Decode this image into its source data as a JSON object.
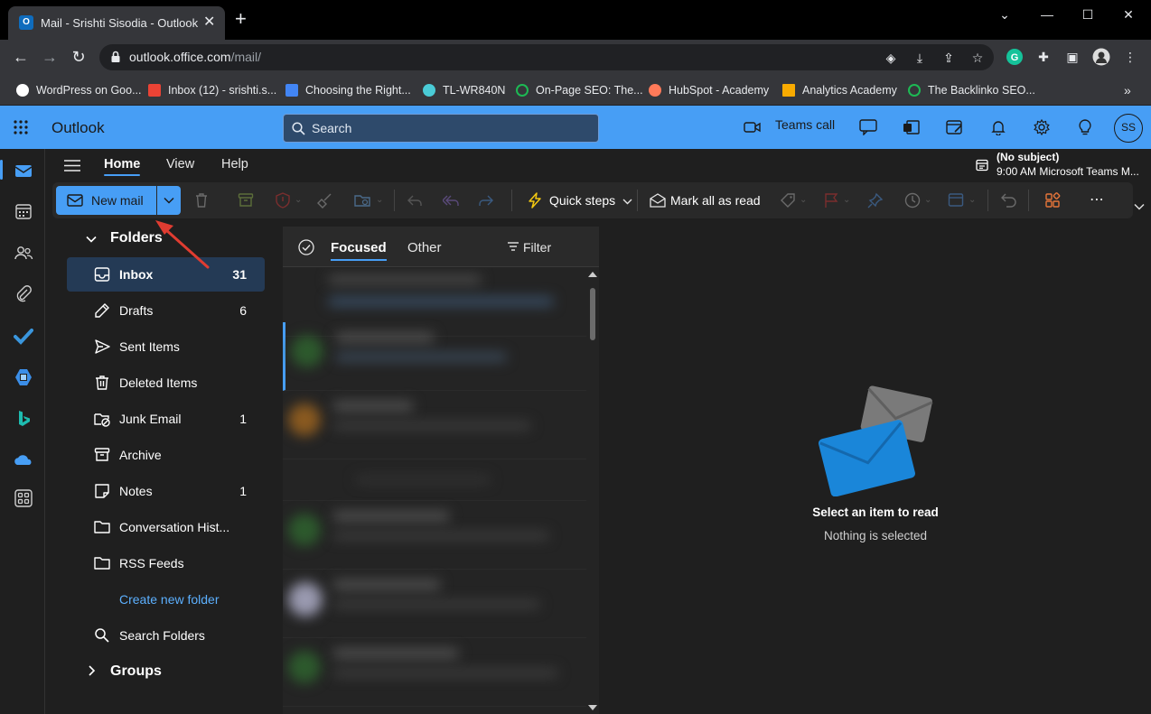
{
  "browser": {
    "tab_title": "Mail - Srishti Sisodia - Outlook",
    "favicon_letter": "O",
    "url_host": "outlook.office.com",
    "url_path": "/mail/",
    "bookmarks": [
      {
        "label": "WordPress on Goo...",
        "color": "#ffffff"
      },
      {
        "label": "Inbox (12) - srishti.s...",
        "color": "#ea4335"
      },
      {
        "label": "Choosing the Right...",
        "color": "#4285f4"
      },
      {
        "label": "TL-WR840N",
        "color": "#4acbd6"
      },
      {
        "label": "On-Page SEO: The...",
        "color": "#1db954"
      },
      {
        "label": "HubSpot - Academy",
        "color": "#ff7a59"
      },
      {
        "label": "Analytics Academy",
        "color": "#f9ab00"
      },
      {
        "label": "The Backlinko SEO...",
        "color": "#1db954"
      }
    ]
  },
  "outlook": {
    "app_name": "Outlook",
    "search_placeholder": "Search",
    "teams_call": "Teams call",
    "avatar_initials": "SS",
    "ribbon_tabs": [
      "Home",
      "View",
      "Help"
    ],
    "meeting": {
      "subject": "(No subject)",
      "detail": "9:00 AM Microsoft Teams M..."
    },
    "toolbar": {
      "new_mail": "New mail",
      "quick_steps": "Quick steps",
      "mark_all_read": "Mark all as read"
    },
    "folders": {
      "folders_header": "Folders",
      "groups_header": "Groups",
      "items": [
        {
          "label": "Inbox",
          "count": "31",
          "icon": "inbox-icon",
          "selected": true
        },
        {
          "label": "Drafts",
          "count": "6",
          "icon": "drafts-icon"
        },
        {
          "label": "Sent Items",
          "count": "",
          "icon": "sent-icon"
        },
        {
          "label": "Deleted Items",
          "count": "",
          "icon": "trash-icon"
        },
        {
          "label": "Junk Email",
          "count": "1",
          "icon": "junk-icon"
        },
        {
          "label": "Archive",
          "count": "",
          "icon": "archive-icon"
        },
        {
          "label": "Notes",
          "count": "1",
          "icon": "notes-icon"
        },
        {
          "label": "Conversation Hist...",
          "count": "",
          "icon": "folder-icon"
        },
        {
          "label": "RSS Feeds",
          "count": "",
          "icon": "folder-icon"
        }
      ],
      "create_new_folder": "Create new folder",
      "search_folders": "Search Folders"
    },
    "message_list": {
      "tab_focused": "Focused",
      "tab_other": "Other",
      "filter": "Filter"
    },
    "reading_pane": {
      "title": "Select an item to read",
      "subtitle": "Nothing is selected"
    },
    "colors": {
      "accent": "#479ef5",
      "background": "#1f1f1f"
    }
  }
}
